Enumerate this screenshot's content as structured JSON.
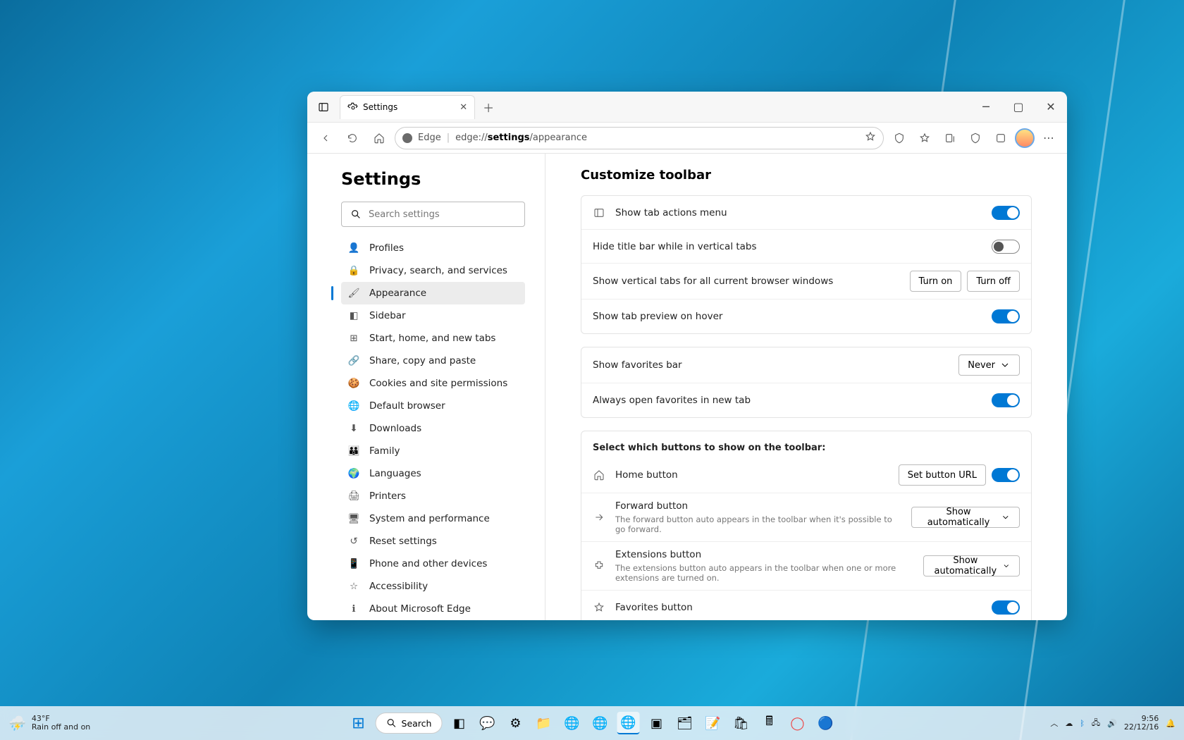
{
  "window": {
    "tab_title": "Settings",
    "address_prefix": "Edge",
    "address_path_prefix": "edge://",
    "address_path_bold": "settings",
    "address_path_suffix": "/appearance"
  },
  "sidebar": {
    "title": "Settings",
    "search_placeholder": "Search settings",
    "items": [
      {
        "label": "Profiles"
      },
      {
        "label": "Privacy, search, and services"
      },
      {
        "label": "Appearance"
      },
      {
        "label": "Sidebar"
      },
      {
        "label": "Start, home, and new tabs"
      },
      {
        "label": "Share, copy and paste"
      },
      {
        "label": "Cookies and site permissions"
      },
      {
        "label": "Default browser"
      },
      {
        "label": "Downloads"
      },
      {
        "label": "Family"
      },
      {
        "label": "Languages"
      },
      {
        "label": "Printers"
      },
      {
        "label": "System and performance"
      },
      {
        "label": "Reset settings"
      },
      {
        "label": "Phone and other devices"
      },
      {
        "label": "Accessibility"
      },
      {
        "label": "About Microsoft Edge"
      }
    ]
  },
  "main": {
    "heading": "Customize toolbar",
    "tab_actions": "Show tab actions menu",
    "hide_title": "Hide title bar while in vertical tabs",
    "vertical_tabs": "Show vertical tabs for all current browser windows",
    "turn_on": "Turn on",
    "turn_off": "Turn off",
    "tab_preview": "Show tab preview on hover",
    "favorites_bar": "Show favorites bar",
    "favorites_bar_value": "Never",
    "favorites_newtab": "Always open favorites in new tab",
    "select_buttons": "Select which buttons to show on the toolbar:",
    "home_btn": "Home button",
    "set_url": "Set button URL",
    "forward_btn": "Forward button",
    "forward_desc": "The forward button auto appears in the toolbar when it's possible to go forward.",
    "show_auto": "Show automatically",
    "ext_btn": "Extensions button",
    "ext_desc": "The extensions button auto appears in the toolbar when one or more extensions are turned on.",
    "fav_btn": "Favorites button"
  },
  "taskbar": {
    "temp": "43°F",
    "weather": "Rain off and on",
    "search": "Search",
    "time": "9:56",
    "date": "22/12/16"
  }
}
